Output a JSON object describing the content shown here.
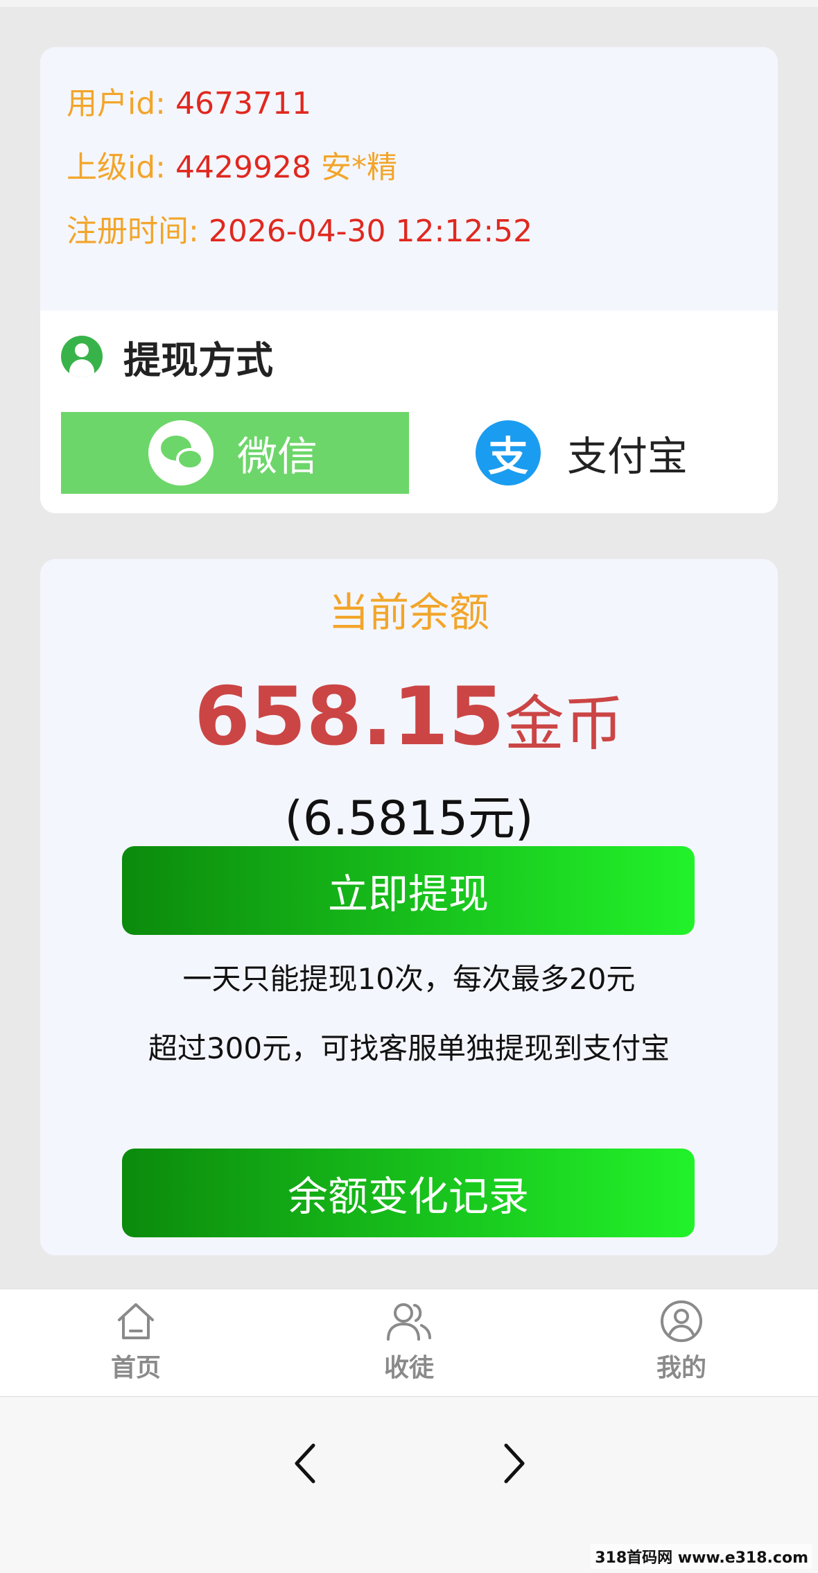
{
  "user_info": {
    "user_id_label": "用户id:",
    "user_id_value": "4673711",
    "parent_id_label": "上级id:",
    "parent_id_value": "4429928",
    "parent_name": "安*精",
    "register_time_label": "注册时间:",
    "register_time_value": "2026-04-30 12:12:52"
  },
  "withdraw_method": {
    "title": "提现方式",
    "options": [
      {
        "label": "微信",
        "selected": true
      },
      {
        "label": "支付宝",
        "selected": false
      }
    ],
    "alipay_glyph": "支"
  },
  "balance": {
    "title": "当前余额",
    "amount": "658.15",
    "unit": "金币",
    "rmb_text": "(6.5815元)",
    "withdraw_button": "立即提现",
    "note1": "一天只能提现10次，每次最多20元",
    "note2": "超过300元，可找客服单独提现到支付宝",
    "records_button": "余额变化记录"
  },
  "tabbar": {
    "home": "首页",
    "disciples": "收徒",
    "mine": "我的"
  },
  "watermark": "318首码网 www.e318.com",
  "colors": {
    "label_orange": "#f2a52a",
    "value_red": "#e0281f",
    "amount_red": "#cb4545",
    "wechat_green": "#6dd66a",
    "alipay_blue": "#1a9cf0"
  }
}
